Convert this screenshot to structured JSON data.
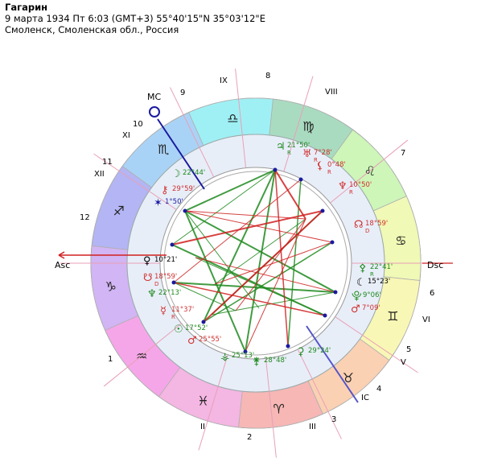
{
  "header": {
    "name": "Гагарин",
    "datetime": "9 марта 1934  Пт   6:03 (GMT+3) 55°40'15\"N  35°03'12\"E",
    "place": "Смоленск, Смоленская обл., Россия"
  },
  "angles": {
    "asc": "Asc",
    "dsc": "Dsc",
    "mc": "MC",
    "ic": "IC"
  },
  "signs": [
    {
      "glyph": "♒",
      "color": "#f5a6e8"
    },
    {
      "glyph": "♓",
      "color": "#f4b6e2"
    },
    {
      "glyph": "♈",
      "color": "#f6b7b5"
    },
    {
      "glyph": "♉",
      "color": "#fbd1b3"
    },
    {
      "glyph": "♊",
      "color": "#f9f7b5"
    },
    {
      "glyph": "♋",
      "color": "#f0f9b5"
    },
    {
      "glyph": "♌",
      "color": "#cdf6b8"
    },
    {
      "glyph": "♍",
      "color": "#a9dbc0"
    },
    {
      "glyph": "♎",
      "color": "#9ff0f4"
    },
    {
      "glyph": "♏",
      "color": "#a9d3f6"
    },
    {
      "glyph": "♐",
      "color": "#b3b5f4"
    },
    {
      "glyph": "♑",
      "color": "#d2b5f4"
    }
  ],
  "house_numbers": [
    {
      "label": "1"
    },
    {
      "label": "II"
    },
    {
      "label": "2"
    },
    {
      "label": "III"
    },
    {
      "label": "3"
    },
    {
      "label": "4"
    },
    {
      "label": "IC"
    },
    {
      "label": "V"
    },
    {
      "label": "5"
    },
    {
      "label": "VI"
    },
    {
      "label": "6"
    },
    {
      "label": "7"
    },
    {
      "label": "VIII"
    },
    {
      "label": "8"
    },
    {
      "label": "IX"
    },
    {
      "label": "9"
    },
    {
      "label": "10"
    },
    {
      "label": "XI"
    },
    {
      "label": "11"
    },
    {
      "label": "XII"
    },
    {
      "label": "12"
    }
  ],
  "planets": [
    {
      "glyph": "♃",
      "deg": "21°50'",
      "retro": "R",
      "color": "#1e8a1e"
    },
    {
      "glyph": "♅",
      "deg": "7°28'",
      "retro": "R",
      "color": "#d03030"
    },
    {
      "glyph": "⚸",
      "deg": "0°48'",
      "retro": "R",
      "color": "#d03030"
    },
    {
      "glyph": "♆",
      "deg": "10°50'",
      "retro": "R",
      "color": "#d03030"
    },
    {
      "glyph": "☊",
      "deg": "18°59'",
      "retro": "D",
      "color": "#d03030"
    },
    {
      "glyph": "⚴",
      "deg": "22°41'",
      "retro": "R",
      "color": "#1e8a1e"
    },
    {
      "glyph": "☾",
      "deg": "15°23'",
      "retro": "",
      "color": "#000000"
    },
    {
      "glyph": "⯓",
      "deg": "9°06'",
      "retro": "",
      "color": "#1e8a1e"
    },
    {
      "glyph": "♂",
      "deg": "7°09'",
      "retro": "",
      "color": "#d03030"
    },
    {
      "glyph": "⚳",
      "deg": "29°24'",
      "retro": "",
      "color": "#1e8a1e"
    },
    {
      "glyph": "⚵",
      "deg": "28°48'",
      "retro": "",
      "color": "#1e8a1e"
    },
    {
      "glyph": "⚶",
      "deg": "25°13'",
      "retro": "",
      "color": "#1e8a1e"
    },
    {
      "glyph": "♂",
      "deg": "25°55'",
      "retro": "",
      "color": "#d03030"
    },
    {
      "glyph": "☉",
      "deg": "17°52'",
      "retro": "",
      "color": "#1e8a1e"
    },
    {
      "glyph": "☿",
      "deg": "11°37'",
      "retro": "R",
      "color": "#d03030"
    },
    {
      "glyph": "♆",
      "deg": "22°13'",
      "retro": "",
      "color": "#1e8a1e"
    },
    {
      "glyph": "☋",
      "deg": "18°59'",
      "retro": "D",
      "color": "#d03030"
    },
    {
      "glyph": "♀",
      "deg": "10°21'",
      "retro": "",
      "color": "#000000"
    },
    {
      "glyph": "✶",
      "deg": "1°50'",
      "retro": "",
      "color": "#1a1aa0"
    },
    {
      "glyph": "⚷",
      "deg": "29°59'",
      "retro": "",
      "color": "#d03030"
    },
    {
      "glyph": "☽",
      "deg": "22°44'",
      "retro": "",
      "color": "#1e8a1e"
    }
  ]
}
